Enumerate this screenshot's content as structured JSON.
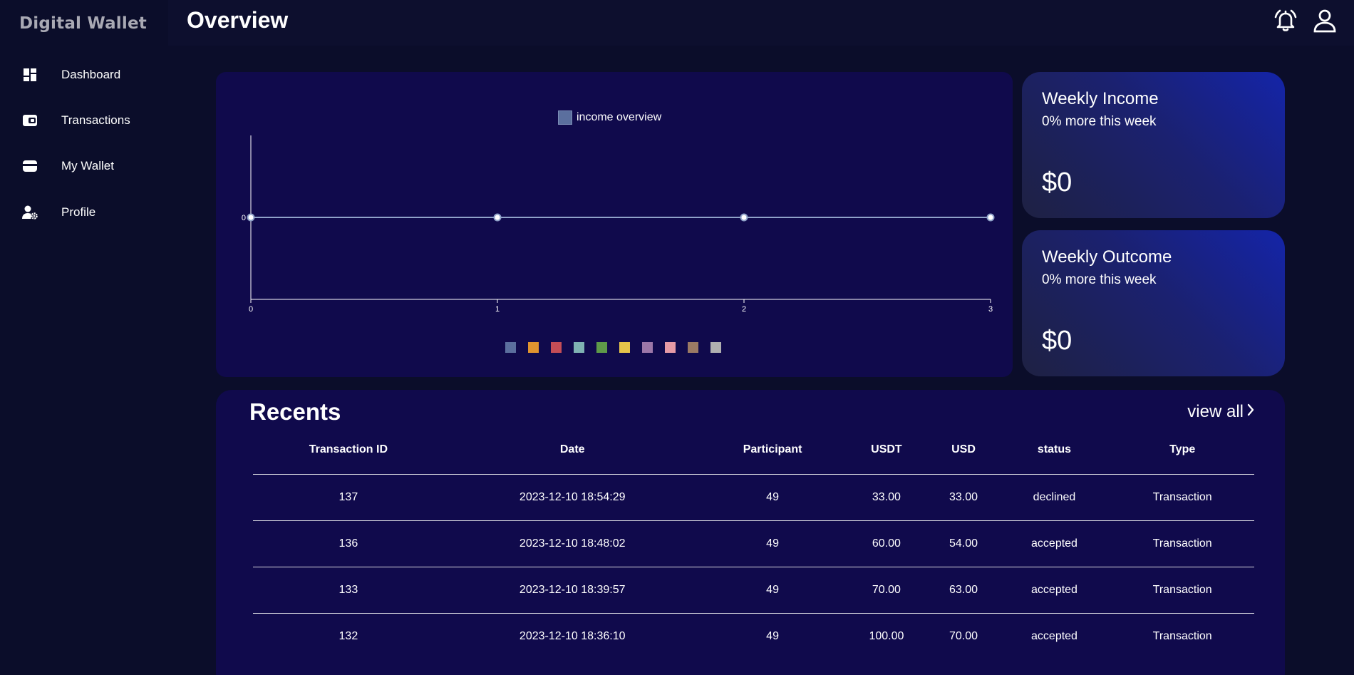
{
  "app": {
    "brand": "Digital Wallet"
  },
  "sidebar": {
    "items": [
      {
        "label": "Dashboard",
        "icon": "dashboard-icon"
      },
      {
        "label": "Transactions",
        "icon": "wallet-card-icon"
      },
      {
        "label": "My Wallet",
        "icon": "wallet-icon"
      },
      {
        "label": "Profile",
        "icon": "user-gear-icon"
      }
    ]
  },
  "header": {
    "title": "Overview",
    "icons": [
      "bell-icon",
      "user-icon"
    ]
  },
  "chart": {
    "legend_label": "income overview",
    "palette": [
      "#5b6f9e",
      "#e0942f",
      "#c44d56",
      "#7fb2b3",
      "#5e9a49",
      "#e6c44a",
      "#9c77a8",
      "#e69aa6",
      "#9b7a64",
      "#b0b0b0"
    ]
  },
  "chart_data": {
    "type": "line",
    "x": [
      0,
      1,
      2,
      3
    ],
    "series": [
      {
        "name": "income overview",
        "values": [
          0,
          0,
          0,
          0
        ]
      }
    ],
    "x_ticks": [
      "0",
      "1",
      "2",
      "3"
    ],
    "y_ticks": [
      "0"
    ],
    "legend_position": "top",
    "grid": false,
    "line_color": "#8fa2c9"
  },
  "stats": {
    "income": {
      "title": "Weekly Income",
      "subtitle": "0% more this week",
      "value": "$0"
    },
    "outcome": {
      "title": "Weekly Outcome",
      "subtitle": "0% more this week",
      "value": "$0"
    }
  },
  "recents": {
    "title": "Recents",
    "view_all": "view all",
    "columns": [
      "Transaction ID",
      "Date",
      "Participant",
      "USDT",
      "USD",
      "status",
      "Type"
    ],
    "rows": [
      {
        "id": "137",
        "date": "2023-12-10 18:54:29",
        "participant": "49",
        "usdt": "33.00",
        "usd": "33.00",
        "status": "declined",
        "type": "Transaction"
      },
      {
        "id": "136",
        "date": "2023-12-10 18:48:02",
        "participant": "49",
        "usdt": "60.00",
        "usd": "54.00",
        "status": "accepted",
        "type": "Transaction"
      },
      {
        "id": "133",
        "date": "2023-12-10 18:39:57",
        "participant": "49",
        "usdt": "70.00",
        "usd": "63.00",
        "status": "accepted",
        "type": "Transaction"
      },
      {
        "id": "132",
        "date": "2023-12-10 18:36:10",
        "participant": "49",
        "usdt": "100.00",
        "usd": "70.00",
        "status": "accepted",
        "type": "Transaction"
      }
    ]
  },
  "colors": {
    "background": "#0b0d2a",
    "card": "#100a4c",
    "declined": "#e0232f",
    "accepted": "#3f9a3f"
  }
}
